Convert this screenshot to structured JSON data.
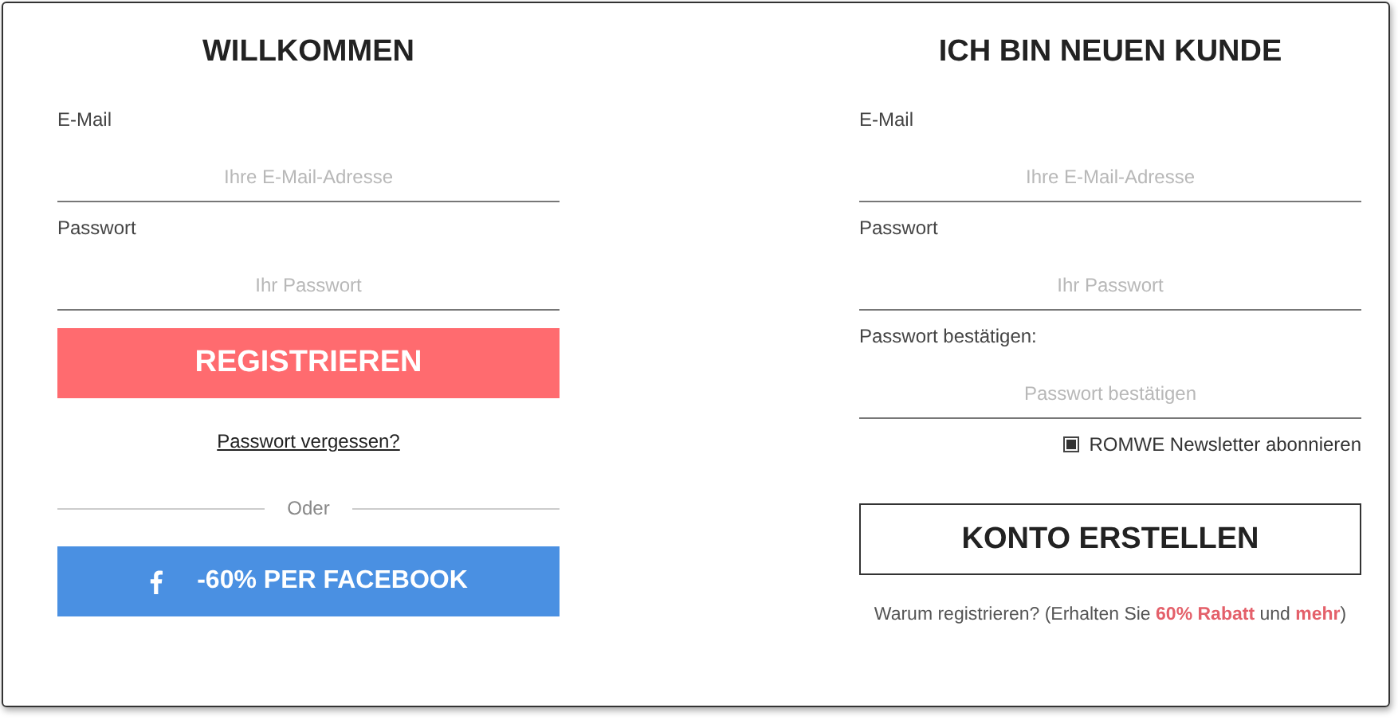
{
  "login": {
    "title": "WILLKOMMEN",
    "fields": [
      {
        "label": "E-Mail",
        "placeholder": "Ihre E-Mail-Adresse"
      },
      {
        "label": "Passwort",
        "placeholder": "Ihr Passwort"
      }
    ],
    "submit": "REGISTRIEREN",
    "forgot_link": "Passwort vergessen?",
    "divider": "Oder",
    "facebook_button": "-60% PER FACEBOOK"
  },
  "register": {
    "title": "ICH BIN NEUEN KUNDE",
    "fields": [
      {
        "label": "E-Mail",
        "placeholder": "Ihre E-Mail-Adresse"
      },
      {
        "label": "Passwort",
        "placeholder": "Ihr Passwort"
      },
      {
        "label": "Passwort bestätigen:",
        "placeholder": "Passwort bestätigen"
      }
    ],
    "newsletter": {
      "label": "ROMWE Newsletter abonnieren",
      "checked": true
    },
    "submit": "KONTO ERSTELLEN",
    "note": "Warum registrieren? (Erhalten Sie **60% Rabatt** und **mehr**)"
  }
}
